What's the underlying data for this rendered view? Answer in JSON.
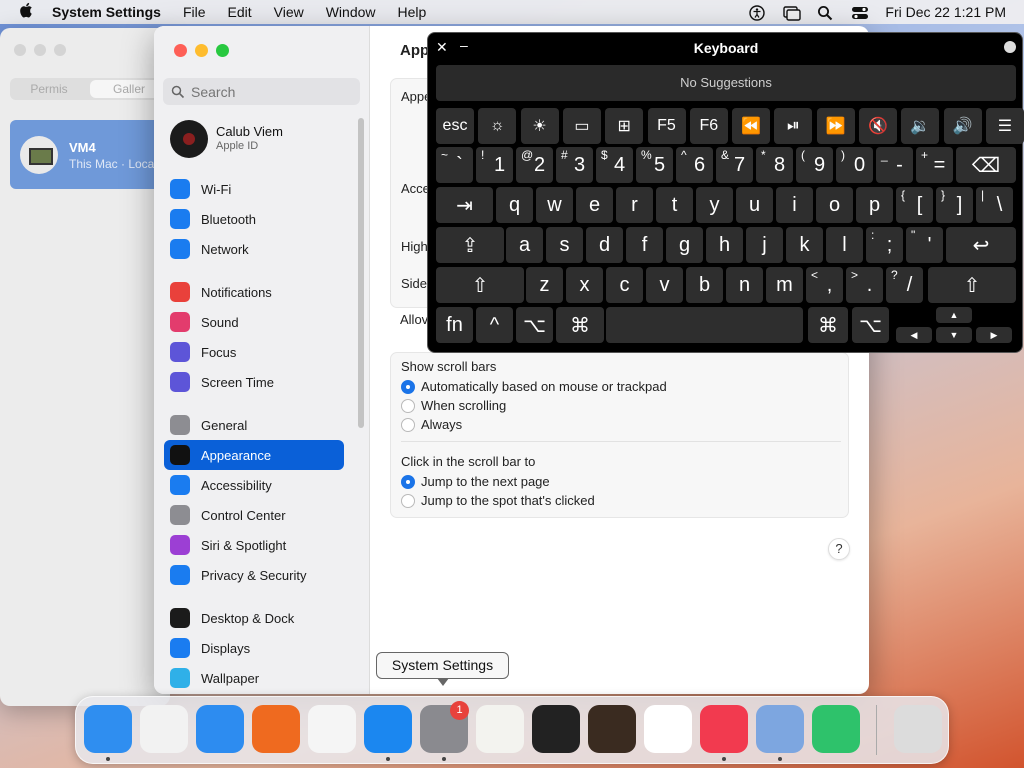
{
  "menubar": {
    "app": "System Settings",
    "menus": [
      "File",
      "Edit",
      "View",
      "Window",
      "Help"
    ],
    "clock": "Fri Dec 22  1:21 PM"
  },
  "bgwindow": {
    "tabs": [
      "Permis",
      "Galler"
    ],
    "vm_name": "VM4",
    "vm_sub": "This Mac · Loca"
  },
  "sidebar": {
    "search_placeholder": "Search",
    "user_name": "Calub Viem",
    "user_sub": "Apple ID",
    "items": [
      {
        "label": "Wi-Fi",
        "color": "#1a7cf0",
        "icon": "wifi-icon"
      },
      {
        "label": "Bluetooth",
        "color": "#1a7cf0",
        "icon": "bluetooth-icon"
      },
      {
        "label": "Network",
        "color": "#1a7cf0",
        "icon": "globe-icon"
      },
      {
        "label": "Notifications",
        "color": "#e9413b",
        "icon": "bell-icon"
      },
      {
        "label": "Sound",
        "color": "#e33c6d",
        "icon": "speaker-icon"
      },
      {
        "label": "Focus",
        "color": "#5d55d8",
        "icon": "moon-icon"
      },
      {
        "label": "Screen Time",
        "color": "#5d55d8",
        "icon": "hourglass-icon"
      },
      {
        "label": "General",
        "color": "#8d8d92",
        "icon": "gear-icon"
      },
      {
        "label": "Appearance",
        "color": "#1b1b1b",
        "icon": "appearance-icon"
      },
      {
        "label": "Accessibility",
        "color": "#1a7cf0",
        "icon": "accessibility-icon"
      },
      {
        "label": "Control Center",
        "color": "#8d8d92",
        "icon": "control-center-icon"
      },
      {
        "label": "Siri & Spotlight",
        "color": "#9c3fd4",
        "icon": "siri-icon"
      },
      {
        "label": "Privacy & Security",
        "color": "#1a7cf0",
        "icon": "hand-icon"
      },
      {
        "label": "Desktop & Dock",
        "color": "#1b1b1b",
        "icon": "dock-icon"
      },
      {
        "label": "Displays",
        "color": "#1a7cf0",
        "icon": "display-icon"
      },
      {
        "label": "Wallpaper",
        "color": "#2fb0e8",
        "icon": "wallpaper-icon"
      }
    ]
  },
  "content": {
    "title": "App",
    "partial_labels": [
      "Appe",
      "Acce",
      "High",
      "Side",
      "Allov"
    ],
    "scroll_bars_label": "Show scroll bars",
    "scroll_options": [
      {
        "label": "Automatically based on mouse or trackpad",
        "selected": true
      },
      {
        "label": "When scrolling",
        "selected": false
      },
      {
        "label": "Always",
        "selected": false
      }
    ],
    "click_label": "Click in the scroll bar to",
    "click_options": [
      {
        "label": "Jump to the next page",
        "selected": true
      },
      {
        "label": "Jump to the spot that's clicked",
        "selected": false
      }
    ],
    "help": "?"
  },
  "keyboard": {
    "title": "Keyboard",
    "close": "✕",
    "minimize": "–",
    "suggestions": "No Suggestions",
    "row0": [
      "esc",
      "☼",
      "☀",
      "▭",
      "⊞",
      "F5",
      "F6",
      "⏪",
      "⏯",
      "⏩",
      "🔇",
      "🔉",
      "🔊",
      "☰"
    ],
    "row1": [
      {
        "sup": "~",
        "main": "`"
      },
      {
        "sup": "!",
        "main": "1"
      },
      {
        "sup": "@",
        "main": "2"
      },
      {
        "sup": "#",
        "main": "3"
      },
      {
        "sup": "$",
        "main": "4"
      },
      {
        "sup": "%",
        "main": "5"
      },
      {
        "sup": "^",
        "main": "6"
      },
      {
        "sup": "&",
        "main": "7"
      },
      {
        "sup": "*",
        "main": "8"
      },
      {
        "sup": "(",
        "main": "9"
      },
      {
        "sup": ")",
        "main": "0"
      },
      {
        "sup": "_",
        "main": "-"
      },
      {
        "sup": "+",
        "main": "="
      }
    ],
    "delete": "⌫",
    "tab": "⇥",
    "row2": [
      "q",
      "w",
      "e",
      "r",
      "t",
      "y",
      "u",
      "i",
      "o",
      "p"
    ],
    "row2_sym": [
      {
        "sup": "{",
        "main": "["
      },
      {
        "sup": "}",
        "main": "]"
      },
      {
        "sup": "|",
        "main": "\\"
      }
    ],
    "caps": "⇪",
    "row3": [
      "a",
      "s",
      "d",
      "f",
      "g",
      "h",
      "j",
      "k",
      "l"
    ],
    "row3_sym": [
      {
        "sup": ":",
        "main": ";"
      },
      {
        "sup": "\"",
        "main": "'"
      }
    ],
    "return": "↩",
    "shift": "⇧",
    "row4": [
      "z",
      "x",
      "c",
      "v",
      "b",
      "n",
      "m"
    ],
    "row4_sym": [
      {
        "sup": "<",
        "main": ","
      },
      {
        "sup": ">",
        "main": "."
      },
      {
        "sup": "?",
        "main": "/"
      }
    ],
    "fn": "fn",
    "ctrl": "^",
    "opt": "⌥",
    "cmd": "⌘",
    "arrows": {
      "up": "▲",
      "left": "◀",
      "down": "▼",
      "right": "▶"
    }
  },
  "tooltip": "System Settings",
  "dock": {
    "badge": "1",
    "apps": [
      {
        "name": "finder-icon",
        "color": "#2f8ef0"
      },
      {
        "name": "launchpad-icon",
        "color": "#f2f2f2"
      },
      {
        "name": "safari-icon",
        "color": "#2d8cf0"
      },
      {
        "name": "firefox-icon",
        "color": "#ef6a1f"
      },
      {
        "name": "chrome-icon",
        "color": "#f5f5f5"
      },
      {
        "name": "app-store-icon",
        "color": "#1b87f0"
      },
      {
        "name": "system-settings-icon",
        "color": "#8a8a8f"
      },
      {
        "name": "textedit-icon",
        "color": "#f3f3ef"
      },
      {
        "name": "terminal-icon",
        "color": "#222222"
      },
      {
        "name": "garageband-icon",
        "color": "#3a2b20"
      },
      {
        "name": "vscode-icon",
        "color": "#ffffff"
      },
      {
        "name": "music-icon",
        "color": "#f23a4f"
      },
      {
        "name": "migration-assistant-icon",
        "color": "#7da6e0"
      },
      {
        "name": "find-my-icon",
        "color": "#2ec26b"
      },
      {
        "name": "trash-icon",
        "color": "#dcdcdc"
      }
    ]
  }
}
